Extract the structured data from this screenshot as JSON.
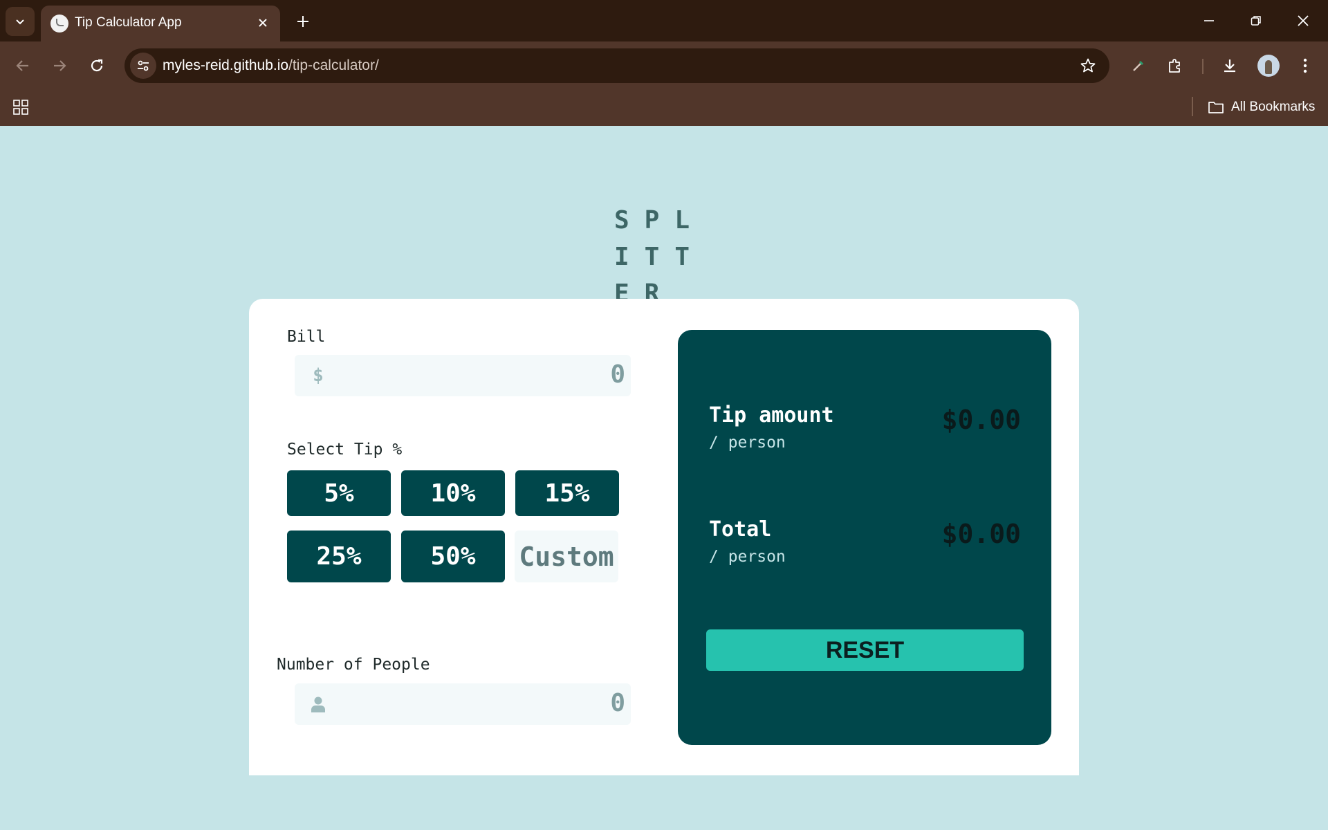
{
  "browser": {
    "tab_title": "Tip Calculator App",
    "url_host": "myles-reid.github.io",
    "url_path": "/tip-calculator/",
    "bookmarks_label": "All Bookmarks"
  },
  "app": {
    "logo": "SPLITTER",
    "bill": {
      "label": "Bill",
      "currency_icon": "$",
      "value": "0"
    },
    "tip": {
      "label": "Select Tip %",
      "options": [
        "5%",
        "10%",
        "15%",
        "25%",
        "50%"
      ],
      "custom_placeholder": "Custom"
    },
    "people": {
      "label": "Number of People",
      "value": "0"
    },
    "results": {
      "tip_amount_label": "Tip amount",
      "tip_amount_sub": "/ person",
      "tip_amount_value": "$0.00",
      "total_label": "Total",
      "total_sub": "/ person",
      "total_value": "$0.00",
      "reset_label": "RESET"
    }
  },
  "colors": {
    "page_background": "#c5e4e7",
    "dark_cyan": "#00474b",
    "accent_cyan": "#26c2ae",
    "chrome_brown": "#51362a"
  }
}
